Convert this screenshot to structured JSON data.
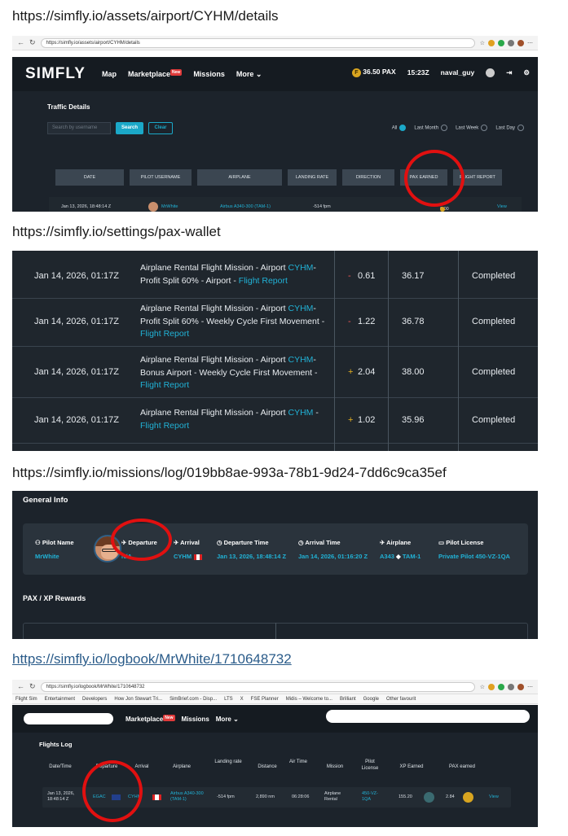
{
  "captions": [
    "https://simfly.io/assets/airport/CYHM/details",
    "https://simfly.io/settings/pax-wallet",
    "https://simfly.io/missions/log/019bb8ae-993a-78b1-9d24-7dd6c9ca35ef",
    "https://simfly.io/logbook/MrWhite/1710648732"
  ],
  "browser1": {
    "url": "https://simfly.io/assets/airport/CYHM/details"
  },
  "browser2": {
    "url": "https://simfly.io/logbook/MrWhite/1710648732"
  },
  "bookmarks": [
    "Flight Sim",
    "Entertainment",
    "Developers",
    "How Jon Stewart Tri...",
    "SimBrief.com - Disp...",
    "LTS",
    "X",
    "FSE Planner",
    "Midis – Welcome to...",
    "Brilliant",
    "Google",
    "Other favourit"
  ],
  "app": {
    "logo": "SIMFLY",
    "nav": [
      "Map",
      "Marketplace",
      "Missions",
      "More"
    ],
    "new_badge": "New",
    "pax_balance": "36.50 PAX",
    "time": "15:23Z",
    "username": "naval_guy"
  },
  "traffic": {
    "title": "Traffic Details",
    "search_placeholder": "Search by username",
    "search_btn": "Search",
    "clear_btn": "Clear",
    "filters": [
      "All",
      "Last Month",
      "Last Week",
      "Last Day"
    ],
    "headers": [
      "DATE",
      "PILOT USERNAME",
      "AIRPLANE",
      "LANDING RATE",
      "DIRECTION",
      "PAX EARNED",
      "FLIGHT REPORT"
    ],
    "row": {
      "date": "Jan 13, 2026, 18:48:14 Z",
      "pilot": "MrWhite",
      "airplane": "Airbus A340-300 (TAM-1)",
      "landing_rate": "-514 fpm",
      "pax": "0.00",
      "report": "View"
    }
  },
  "wallet": {
    "rows": [
      {
        "date": "Jan 14, 2026, 01:17Z",
        "d1": "Airplane Rental Flight Mission - Airport ",
        "icao": "CYHM",
        "d2": "- Profit Split 60% - Airport - ",
        "link": "Flight Report",
        "sign": "-",
        "amount": "0.61",
        "balance": "36.17",
        "status": "Completed"
      },
      {
        "date": "Jan 14, 2026, 01:17Z",
        "d1": "Airplane Rental Flight Mission - Airport ",
        "icao": "CYHM",
        "d2": "- Profit Split 60% - Weekly Cycle First Movement - ",
        "link": "Flight Report",
        "sign": "-",
        "amount": "1.22",
        "balance": "36.78",
        "status": "Completed"
      },
      {
        "date": "Jan 14, 2026, 01:17Z",
        "d1": "Airplane Rental Flight Mission - Airport ",
        "icao": "CYHM",
        "d2": "- Bonus Airport - Weekly Cycle First Movement - ",
        "link": "Flight Report",
        "sign": "+",
        "amount": "2.04",
        "balance": "38.00",
        "status": "Completed"
      },
      {
        "date": "Jan 14, 2026, 01:17Z",
        "d1": "Airplane Rental Flight Mission - Airport ",
        "icao": "CYHM",
        "d2": " - ",
        "link": "Flight Report",
        "sign": "+",
        "amount": "1.02",
        "balance": "35.96",
        "status": "Completed"
      }
    ]
  },
  "mission": {
    "title": "General Info",
    "fields": [
      {
        "label": "Pilot Name",
        "value": "MrWhite"
      },
      {
        "label": "Departure",
        "value": "N/A"
      },
      {
        "label": "Arrival",
        "value": "CYHM"
      },
      {
        "label": "Departure Time",
        "value": "Jan 13, 2026, 18:48:14 Z"
      },
      {
        "label": "Arrival Time",
        "value": "Jan 14, 2026, 01:16:20 Z"
      },
      {
        "label": "Airplane",
        "value": "A343",
        "value2": "TAM-1"
      },
      {
        "label": "Pilot License",
        "value": "Private Pilot 450-VZ-1QA"
      }
    ],
    "rewards_title": "PAX / XP Rewards"
  },
  "logbook": {
    "title": "Flights Log",
    "headers": [
      "Date/Time",
      "Departure",
      "Arrival",
      "Airplane",
      "Landing rate",
      "Distance",
      "Air Time",
      "Mission",
      "Pilot License",
      "XP Earned",
      "PAX earned"
    ],
    "row": {
      "date": "Jan 13, 2026, 18:48:14 Z",
      "departure": "EGAC",
      "arrival": "CYHM",
      "airplane": "Airbus A340-300 (TAM-1)",
      "landing": "-514 fpm",
      "distance": "2,890 nm",
      "airtime": "06:28:06",
      "mission": "Airplane Rental",
      "license": "450-VZ-1QA",
      "xp": "155.20",
      "pax": "2.84",
      "view": "View"
    }
  },
  "colors": {
    "accent": "#21b2d6",
    "panel": "#1c232b",
    "annotation": "#e11010"
  }
}
